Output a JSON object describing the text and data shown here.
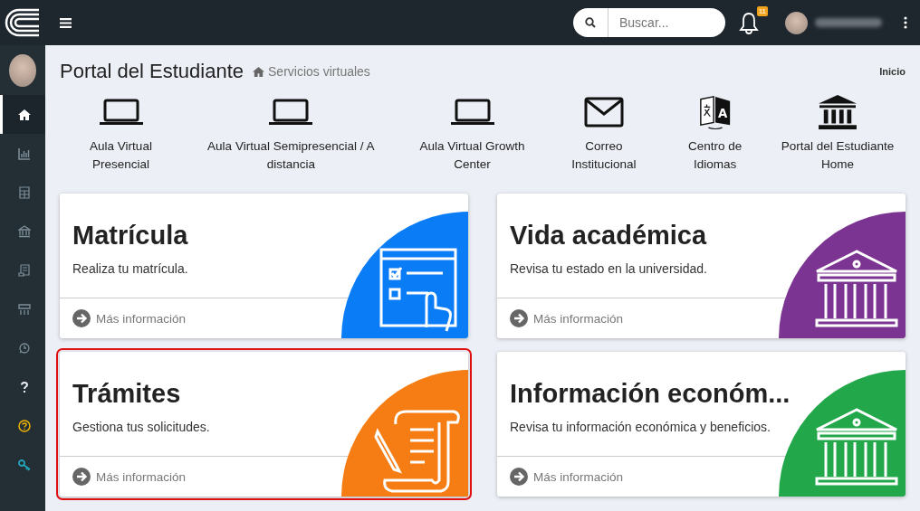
{
  "topbar": {
    "search": {
      "placeholder": "Buscar..."
    },
    "notifications": {
      "count": "11"
    }
  },
  "sidebar": {
    "items": [
      {
        "kind": "home",
        "selected": true
      },
      {
        "kind": "chart",
        "selected": false
      },
      {
        "kind": "calendar",
        "selected": false
      },
      {
        "kind": "bank",
        "selected": false
      },
      {
        "kind": "scroll",
        "selected": false
      },
      {
        "kind": "group",
        "selected": false
      },
      {
        "kind": "clock",
        "selected": false
      },
      {
        "kind": "question",
        "selected": false
      },
      {
        "kind": "help",
        "selected": false
      },
      {
        "kind": "key",
        "selected": false
      }
    ]
  },
  "header": {
    "title": "Portal del Estudiante",
    "breadcrumb": "Servicios virtuales",
    "link": "Inicio"
  },
  "shortcuts": [
    {
      "kind": "laptop",
      "label": "Aula Virtual Presencial"
    },
    {
      "kind": "laptop",
      "label": "Aula Virtual Semipresencial / A distancia"
    },
    {
      "kind": "laptop",
      "label": "Aula Virtual Growth Center"
    },
    {
      "kind": "envelope",
      "label": "Correo Institucional"
    },
    {
      "kind": "translate",
      "label": "Centro de Idiomas",
      "glyph": "A"
    },
    {
      "kind": "bank",
      "label": "Portal del Estudiante Home"
    }
  ],
  "cards": [
    {
      "kind": "form",
      "title": "Matrícula",
      "subtitle": "Realiza tu matrícula.",
      "link": "Más información",
      "color": "#0a7cf5",
      "highlighted": false
    },
    {
      "kind": "building",
      "title": "Vida académica",
      "subtitle": "Revisa tu estado en la universidad.",
      "link": "Más información",
      "color": "#7b3491",
      "highlighted": false
    },
    {
      "kind": "scroll",
      "title": "Trámites",
      "subtitle": "Gestiona tus solicitudes.",
      "link": "Más información",
      "color": "#f57d13",
      "highlighted": true
    },
    {
      "kind": "building",
      "title": "Información económ...",
      "subtitle": "Revisa tu información económica y beneficios.",
      "link": "Más información",
      "color": "#22a84a",
      "highlighted": false
    }
  ]
}
